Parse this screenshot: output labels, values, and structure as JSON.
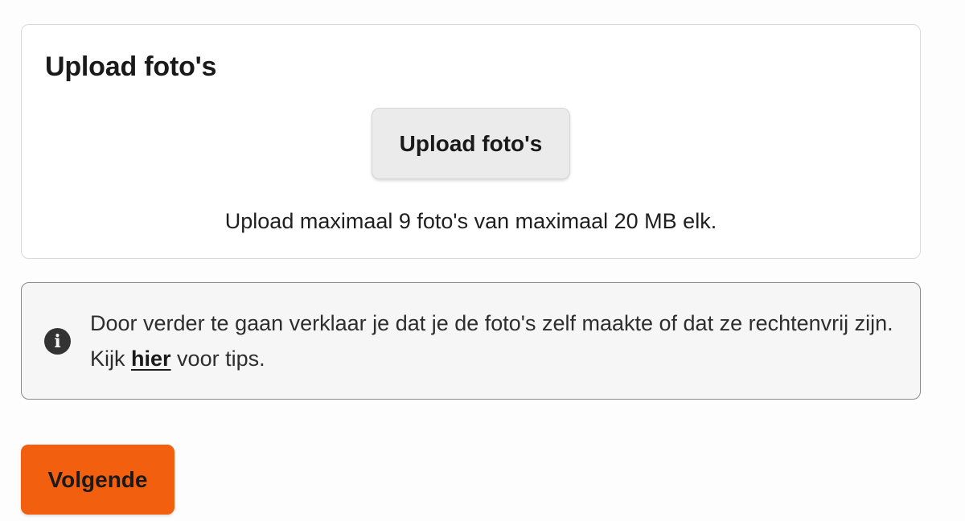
{
  "upload_card": {
    "title": "Upload foto's",
    "button_label": "Upload foto's",
    "note": "Upload maximaal 9 foto's van maximaal 20 MB elk."
  },
  "info_box": {
    "icon": "info-icon",
    "text_before": "Door verder te gaan verklaar je dat je de foto's zelf maakte of dat ze rechtenvrij zijn. Kijk ",
    "link_text": "hier",
    "text_after": " voor tips."
  },
  "footer": {
    "next_label": "Volgende"
  },
  "colors": {
    "accent": "#f2600f",
    "upload_button_bg": "#ebebeb",
    "info_bg": "#f6f6f6"
  }
}
